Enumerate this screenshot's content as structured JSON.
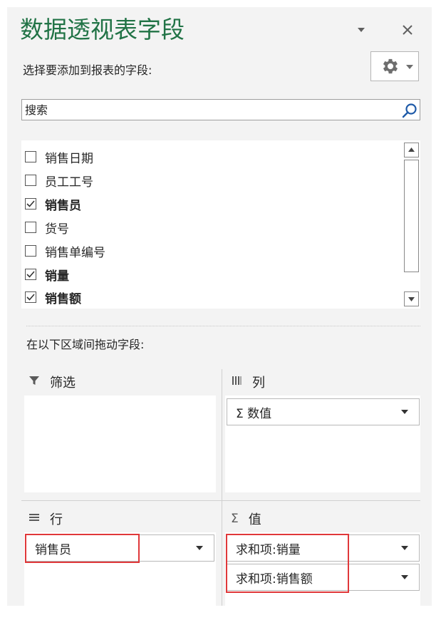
{
  "panel": {
    "title": "数据透视表字段",
    "subtitle": "选择要添加到报表的字段:",
    "search_placeholder": "搜索",
    "drag_label": "在以下区域间拖动字段:"
  },
  "fields": [
    {
      "label": "销售日期",
      "checked": false
    },
    {
      "label": "员工工号",
      "checked": false
    },
    {
      "label": "销售员",
      "checked": true
    },
    {
      "label": "货号",
      "checked": false
    },
    {
      "label": "销售单编号",
      "checked": false
    },
    {
      "label": "销量",
      "checked": true
    },
    {
      "label": "销售额",
      "checked": true
    }
  ],
  "areas": {
    "filter": {
      "label": "筛选",
      "icon": "filter-icon"
    },
    "columns": {
      "label": "列",
      "icon": "columns-icon",
      "items": [
        "Σ 数值"
      ]
    },
    "rows": {
      "label": "行",
      "icon": "rows-icon",
      "items": [
        "销售员"
      ]
    },
    "values": {
      "label": "值",
      "icon": "sigma-icon",
      "items": [
        "求和项:销量",
        "求和项:销售额"
      ]
    }
  },
  "colors": {
    "title": "#217346",
    "highlight": "#e0383a",
    "pane": "#f3f3f3"
  }
}
